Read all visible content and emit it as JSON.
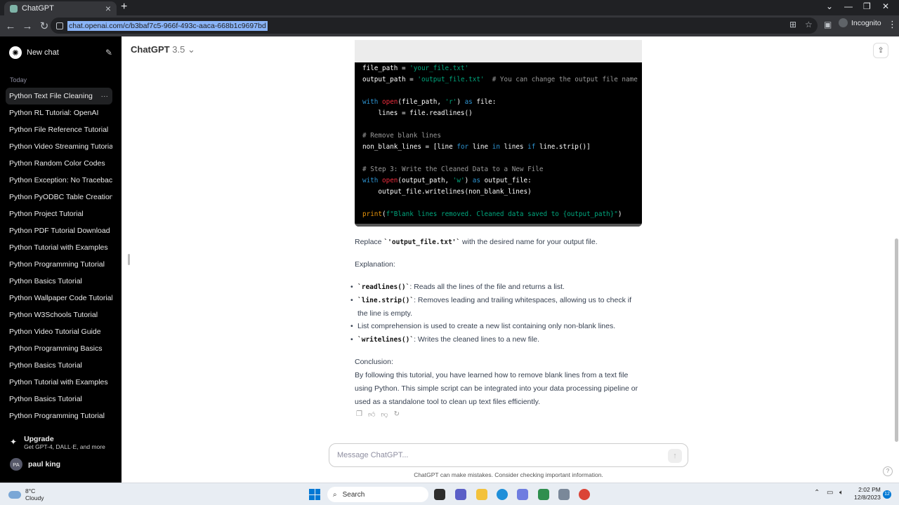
{
  "browser": {
    "tab_title": "ChatGPT",
    "tab_close": "×",
    "new_tab": "+",
    "url": "chat.openai.com/c/b3baf7c5-966f-493c-aaca-668b1c9697bd",
    "profile": "Incognito",
    "back": "←",
    "forward": "→",
    "reload": "↻",
    "minimize": "⌄",
    "min": "—",
    "max": "❐",
    "close": "✕"
  },
  "sidebar": {
    "new_chat": "New chat",
    "today_label": "Today",
    "items": [
      {
        "label": "Python Text File Cleaning",
        "active": true
      },
      {
        "label": "Python RL Tutorial: OpenAI"
      },
      {
        "label": "Python File Reference Tutorial"
      },
      {
        "label": "Python Video Streaming Tutorial"
      },
      {
        "label": "Python Random Color Codes"
      },
      {
        "label": "Python Exception: No Traceback"
      },
      {
        "label": "Python PyODBC Table Creation"
      },
      {
        "label": "Python Project Tutorial"
      },
      {
        "label": "Python PDF Tutorial Download"
      },
      {
        "label": "Python Tutorial with Examples"
      },
      {
        "label": "Python Programming Tutorial"
      },
      {
        "label": "Python Basics Tutorial"
      },
      {
        "label": "Python Wallpaper Code Tutorial"
      },
      {
        "label": "Python W3Schools Tutorial"
      },
      {
        "label": "Python Video Tutorial Guide"
      },
      {
        "label": "Python Programming Basics"
      },
      {
        "label": "Python Basics Tutorial"
      },
      {
        "label": "Python Tutorial with Examples"
      },
      {
        "label": "Python Basics Tutorial"
      },
      {
        "label": "Python Programming Tutorial"
      }
    ],
    "upgrade_title": "Upgrade",
    "upgrade_sub": "Get GPT-4, DALL·E, and more",
    "user_initials": "PA",
    "user_name": "paul king"
  },
  "main": {
    "model_name": "ChatGPT",
    "model_version": "3.5",
    "replace_pre": "Replace ",
    "replace_code": "`'output_file.txt'`",
    "replace_post": " with the desired name for your output file.",
    "explanation": "Explanation:",
    "bullets": [
      {
        "code": "`readlines()`",
        "text": ": Reads all the lines of the file and returns a list."
      },
      {
        "code": "`line.strip()`",
        "text": ": Removes leading and trailing whitespaces, allowing us to check if the line is empty."
      },
      {
        "code": "",
        "text": "List comprehension is used to create a new list containing only non-blank lines."
      },
      {
        "code": "`writelines()`",
        "text": ": Writes the cleaned lines to a new file."
      }
    ],
    "conclusion_label": "Conclusion:",
    "conclusion_text": "By following this tutorial, you have learned how to remove blank lines from a text file using Python. This simple script can be integrated into your data processing pipeline or used as a standalone tool to clean up text files efficiently.",
    "composer_placeholder": "Message ChatGPT...",
    "disclaimer": "ChatGPT can make mistakes. Consider checking important information.",
    "help": "?"
  },
  "code": {
    "l1a": "file_path = ",
    "l1b": "'your_file.txt'",
    "l2a": "output_path = ",
    "l2b": "'output_file.txt'",
    "l2c": "  # You can change the output file name",
    "l3a": "with ",
    "l3b": "open",
    "l3c": "(file_path, ",
    "l3d": "'r'",
    "l3e": ") ",
    "l3f": "as",
    "l3g": " file:",
    "l4": "    lines = file.readlines()",
    "l5": "# Remove blank lines",
    "l6a": "non_blank_lines = [line ",
    "l6b": "for",
    "l6c": " line ",
    "l6d": "in",
    "l6e": " lines ",
    "l6f": "if",
    "l6g": " line.strip()]",
    "l7": "# Step 3: Write the Cleaned Data to a New File",
    "l8a": "with ",
    "l8b": "open",
    "l8c": "(output_path, ",
    "l8d": "'w'",
    "l8e": ") ",
    "l8f": "as",
    "l8g": " output_file:",
    "l9": "    output_file.writelines(non_blank_lines)",
    "l10a": "print",
    "l10b": "(",
    "l10c": "f\"Blank lines removed. Cleaned data saved to {output_path}\"",
    "l10d": ")"
  },
  "taskbar": {
    "temp": "8°C",
    "condition": "Cloudy",
    "search": "Search",
    "time": "2:02 PM",
    "date": "12/8/2023",
    "notifications": "12"
  }
}
